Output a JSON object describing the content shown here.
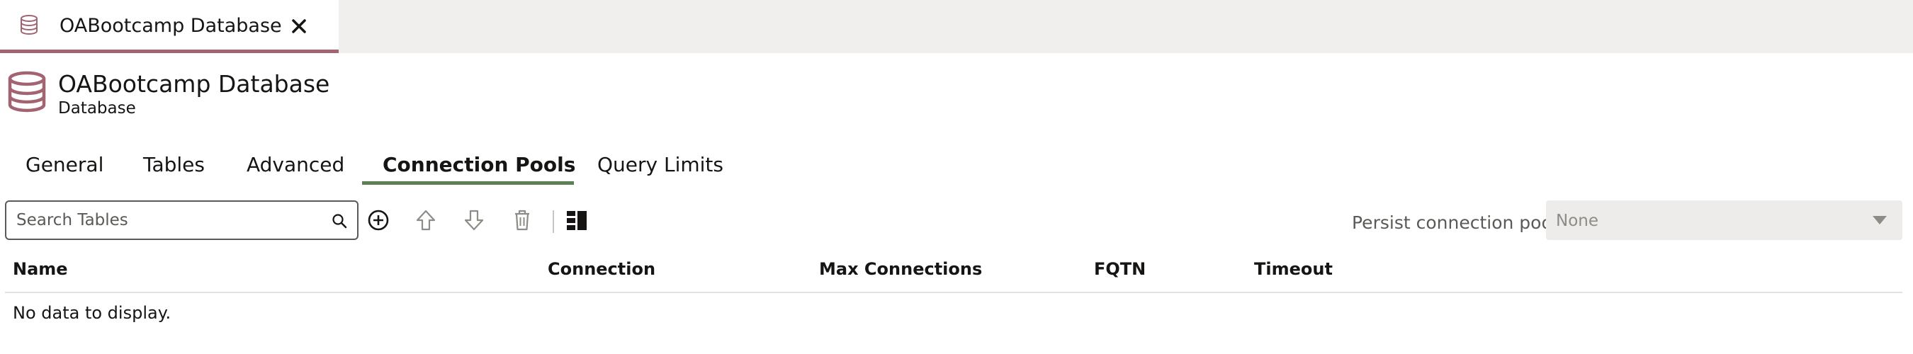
{
  "doc_tab": {
    "title": "OABootcamp Database",
    "icon": "database-icon",
    "close_icon": "close-icon"
  },
  "header": {
    "title": "OABootcamp Database",
    "subtitle": "Database",
    "icon": "database-icon"
  },
  "tabs": [
    {
      "label": "General",
      "active": false
    },
    {
      "label": "Tables",
      "active": false
    },
    {
      "label": "Advanced",
      "active": false
    },
    {
      "label": "Connection Pools",
      "active": true
    },
    {
      "label": "Query Limits",
      "active": false
    }
  ],
  "toolbar": {
    "search_placeholder": "Search Tables",
    "icons": [
      "add-icon",
      "move-up-icon",
      "move-down-icon",
      "delete-icon",
      "columns-layout-icon"
    ]
  },
  "persist": {
    "label": "Persist connection pool",
    "value": "None"
  },
  "table": {
    "columns": [
      "Name",
      "Connection",
      "Max Connections",
      "FQTN",
      "Timeout"
    ],
    "empty_text": "No data to display."
  },
  "colors": {
    "accent_tab": "#a36472",
    "active_subtab": "#5c7f56",
    "icon": "#a36472"
  }
}
